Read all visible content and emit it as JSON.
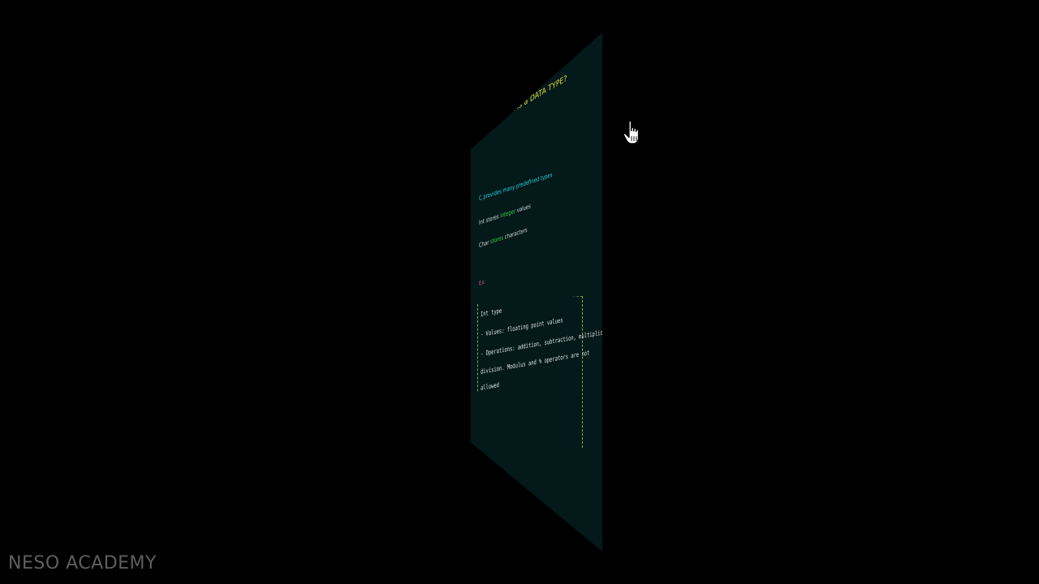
{
  "slide": {
    "title": "What is a DATA TYPE?",
    "intro": "C provides many predefined types",
    "point_1_pre": "Int",
    "point_1_mid": "stores",
    "point_1_hl": "integer",
    "point_1_post": "values",
    "point_2_pre": "Char",
    "point_2_hl": "stores",
    "point_2_post": "characters",
    "example_label": "Ex:",
    "box": {
      "heading": "Int type",
      "line_1": "- Values: floating point values",
      "line_2": "- Operations: addition, subtraction, multiplication,",
      "line_3": "  division. Modulus and % operators are not",
      "line_4": "  allowed"
    }
  },
  "watermark": "NESO ACADEMY",
  "cursor": "hand-pointer-icon",
  "colors": {
    "background": "#000000",
    "slide_bg": "#03191a",
    "title": "#e8e23a",
    "accent_cyan": "#26d0d8",
    "accent_green": "#3bd14a",
    "accent_pink": "#d94a8a",
    "box_border": "#7fb03a",
    "watermark": "#5f5f5f"
  }
}
